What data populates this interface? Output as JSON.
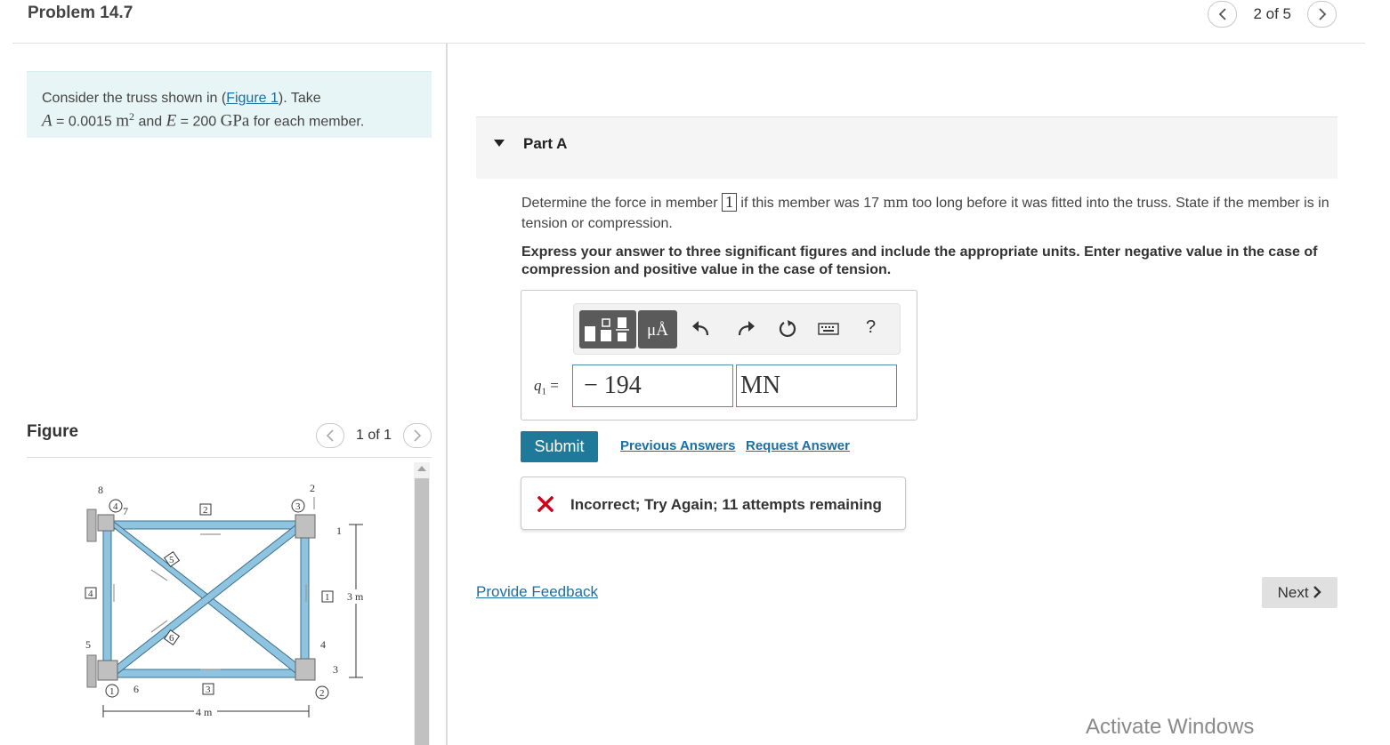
{
  "header": {
    "title": "Problem 14.7",
    "pager": "2 of 5"
  },
  "problem": {
    "text_1": "Consider the truss shown in (",
    "figure_link": "Figure 1",
    "text_2": "). Take",
    "area_var": "A",
    "area_eq": " = 0.0015 ",
    "area_unit": "m",
    "area_exp": "2",
    "and": " and ",
    "modulus_var": "E",
    "modulus_eq": " = 200 ",
    "modulus_unit": "GPa",
    "tail": " for each member."
  },
  "figure_panel": {
    "label": "Figure",
    "pager": "1 of 1"
  },
  "truss": {
    "dim_horizontal": "4 m",
    "dim_vertical": "3 m",
    "node_labels": [
      "1",
      "2",
      "3",
      "4"
    ],
    "member_labels": [
      "1",
      "2",
      "3",
      "4",
      "5",
      "6"
    ],
    "side_labels": [
      "8",
      "7",
      "2",
      "1",
      "4",
      "5",
      "6",
      "3"
    ]
  },
  "part": {
    "label": "Part A",
    "question_1": "Determine the force in member ",
    "member": "1",
    "question_2": " if this member was 17 ",
    "question_unit": "mm",
    "question_3": " too long before it was fitted into the truss. State if the member is in tension or compression.",
    "instruction": "Express your answer to three significant figures and include the appropriate units. Enter negative value in the case of compression and positive value in the case of tension."
  },
  "answer": {
    "units_button": "μÅ",
    "help": "?",
    "var_name": "q",
    "var_sub": "1",
    "equals": " =",
    "value": "− 194",
    "unit": "MN"
  },
  "actions": {
    "submit": "Submit",
    "previous_answers": "Previous Answers",
    "request_answer": "Request Answer"
  },
  "feedback": {
    "message": "Incorrect; Try Again; 11 attempts remaining"
  },
  "footer": {
    "provide_feedback": "Provide Feedback",
    "next": "Next"
  },
  "watermark": "Activate Windows",
  "colors": {
    "accent": "#1f7a99",
    "link": "#1a6fa3",
    "error": "#d0021b",
    "member_fill": "#8fc4e0"
  },
  "icons": [
    "chevron-left-icon",
    "chevron-right-icon",
    "caret-down-icon",
    "templates-icon",
    "undo-icon",
    "redo-icon",
    "reset-icon",
    "keyboard-icon",
    "x-mark-icon"
  ]
}
